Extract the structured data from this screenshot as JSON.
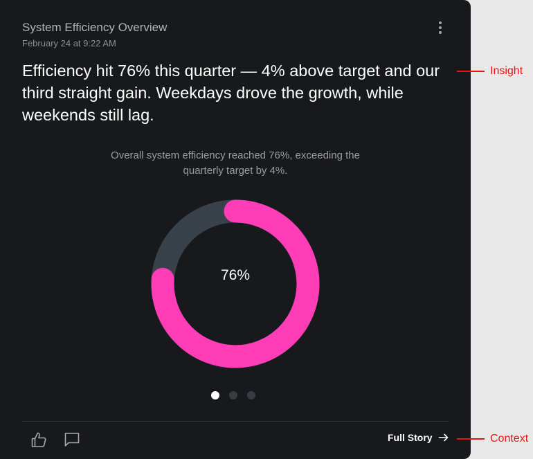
{
  "card": {
    "title": "System Efficiency Overview",
    "timestamp": "February 24 at 9:22 AM",
    "insight": "Efficiency hit 76% this quarter — 4% above target and our third straight gain. Weekdays drove the growth, while weekends still lag.",
    "chart_caption": "Overall system efficiency reached 76%, exceeding the quarterly target by 4%.",
    "footer": {
      "full_story_label": "Full Story"
    }
  },
  "chart_data": {
    "type": "pie",
    "variant": "donut",
    "values": [
      76,
      24
    ],
    "center_label": "76%",
    "colors": {
      "value": "#ff3db7",
      "remainder": "#39414b"
    }
  },
  "pager": {
    "count": 3,
    "active_index": 0
  },
  "annotations": {
    "insight": "Insight",
    "context": "Context"
  },
  "icons": {
    "more": "more-vertical-icon",
    "like": "thumbs-up-icon",
    "comment": "comment-icon",
    "arrow": "arrow-right-icon"
  }
}
